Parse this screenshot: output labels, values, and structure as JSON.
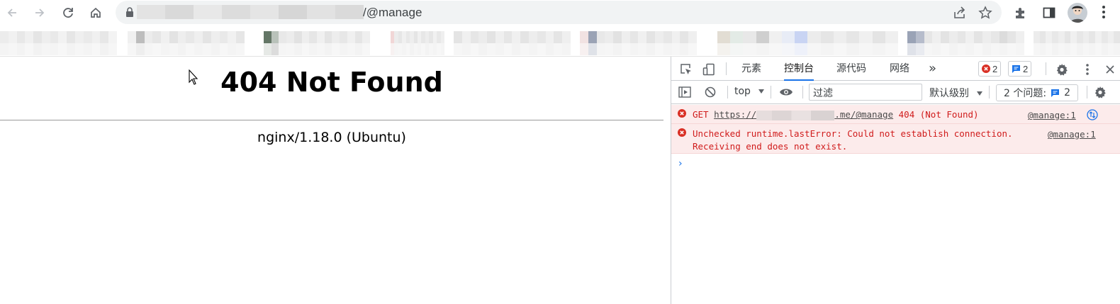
{
  "browser": {
    "url_path": "/@manage",
    "icons": {
      "back": "arrow-left-icon",
      "forward": "arrow-right-icon",
      "reload": "reload-icon",
      "home": "home-icon",
      "lock": "lock-icon",
      "share": "share-icon",
      "bookmark": "star-icon",
      "extensions": "puzzle-icon",
      "side_panel": "side-panel-icon",
      "profile": "avatar",
      "menu": "kebab-menu-icon"
    }
  },
  "page": {
    "heading": "404 Not Found",
    "server_line": "nginx/1.18.0 (Ubuntu)"
  },
  "devtools": {
    "tabs": [
      {
        "label": "元素",
        "active": false
      },
      {
        "label": "控制台",
        "active": true
      },
      {
        "label": "源代码",
        "active": false
      },
      {
        "label": "网络",
        "active": false
      }
    ],
    "more_tabs": "»",
    "error_count": "2",
    "message_count": "2",
    "context_select": "top",
    "filter_placeholder": "过滤",
    "level_select": "默认级别",
    "issues_label": "2 个问题:",
    "issues_count": "2",
    "colors": {
      "accent": "#1a73e8",
      "error_text": "#d01b1b",
      "error_bg": "#fcebeb"
    }
  },
  "console": {
    "messages": [
      {
        "method": "GET",
        "url_prefix": "https://",
        "url_suffix": ".me/@manage",
        "status": "404 (Not Found)",
        "source": "@manage:1"
      },
      {
        "line1": "Unchecked runtime.lastError: Could not establish connection.",
        "line2": "Receiving end does not exist.",
        "source": "@manage:1"
      }
    ],
    "prompt": "›"
  }
}
